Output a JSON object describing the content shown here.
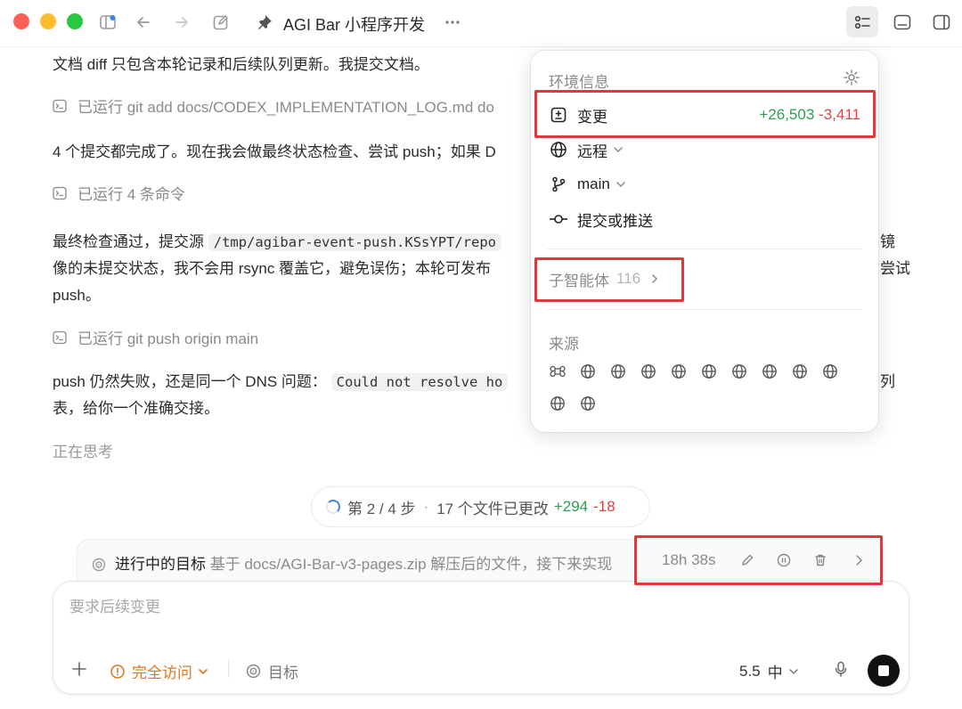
{
  "window": {
    "title": "AGI Bar 小程序开发"
  },
  "conversation": {
    "line1": "文档 diff 只包含本轮记录和后续队列更新。我提交文档。",
    "cmd1": "已运行 git add docs/CODEX_IMPLEMENTATION_LOG.md do",
    "line2": "4 个提交都完成了。现在我会做最终状态检查、尝试 push；如果 D",
    "cmd2": "已运行 4 条命令",
    "line3a_pre": "最终检查通过，提交源",
    "line3a_code": "/tmp/agibar-event-push.KSsYPT/repo",
    "line3a_tail": "镜",
    "line3b_pre": "像的未提交状态，我不会用 rsync 覆盖它，避免误伤；本轮可发布",
    "line3b_tail": "尝试",
    "line3c": "push。",
    "cmd3": "已运行 git push origin main",
    "line4_pre": "push 仍然失败，还是同一个 DNS 问题：",
    "line4_code": "Could not resolve ho",
    "line4_tail": "列",
    "line5": "表，给你一个准确交接。",
    "thinking": "正在思考"
  },
  "popover": {
    "header": "环境信息",
    "changes": {
      "label": "变更",
      "added": "+26,503",
      "removed": "-3,411"
    },
    "remote": {
      "label": "远程"
    },
    "branch": {
      "label": "main"
    },
    "commit": {
      "label": "提交或推送"
    },
    "subagents": {
      "label": "子智能体",
      "count": "116"
    },
    "sources": {
      "label": "来源"
    }
  },
  "status": {
    "step": "第 2 / 4 步",
    "dot": "·",
    "files": "17 个文件已更改",
    "added": "+294",
    "removed": "-18"
  },
  "goal": {
    "title": "进行中的目标",
    "desc": "基于 docs/AGI-Bar-v3-pages.zip 解压后的文件，接下来实现",
    "elapsed": "18h 38s"
  },
  "composer": {
    "placeholder": "要求后续变更",
    "access": "完全访问",
    "goal": "目标",
    "model": "5.5",
    "effort": "中"
  },
  "colors": {
    "added": "#2e9e4f",
    "removed": "#d64545",
    "highlight": "#e0383e",
    "access": "#d9781f"
  },
  "icons": [
    "sidebar-icon",
    "back-arrow-icon",
    "forward-arrow-icon",
    "edit-icon",
    "pin-icon",
    "more-icon",
    "checklist-icon",
    "terminal-panel-icon",
    "right-panel-icon",
    "terminal-icon",
    "gear-icon",
    "diff-icon",
    "globe-icon",
    "branch-icon",
    "commit-icon",
    "chevron-right-icon",
    "chevron-down-icon",
    "spinner-icon",
    "target-icon",
    "pencil-icon",
    "pause-icon",
    "trash-icon",
    "plus-icon",
    "warning-icon",
    "mic-icon",
    "stop-icon"
  ]
}
